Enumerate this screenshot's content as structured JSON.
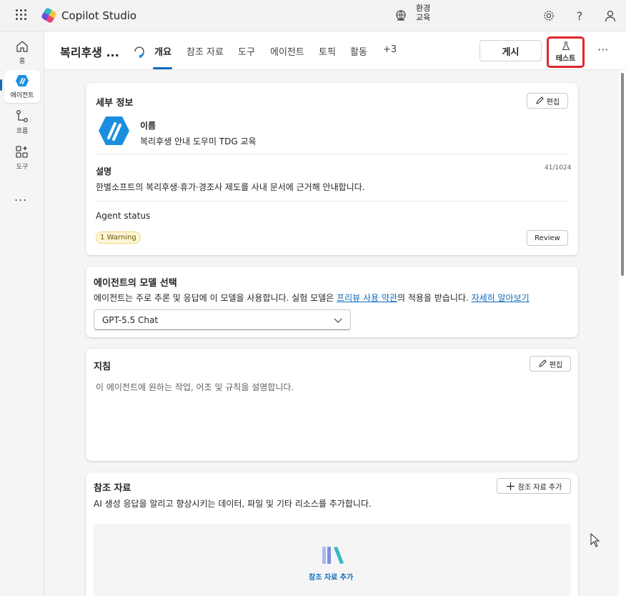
{
  "topbar": {
    "app_title": "Copilot Studio",
    "env_label_1": "환경",
    "env_label_2": "교육",
    "icons": [
      "waffle-icon",
      "settings-icon",
      "help-icon",
      "profile-icon"
    ]
  },
  "rail": {
    "items": [
      {
        "label": "홈",
        "icon": "home-icon"
      },
      {
        "label": "에이전트",
        "icon": "agent-icon"
      },
      {
        "label": "흐름",
        "icon": "flow-icon"
      },
      {
        "label": "도구",
        "icon": "tools-icon"
      }
    ],
    "more": "..."
  },
  "header": {
    "agent_name": "복리후생 ...",
    "tabs": [
      "개요",
      "참조 자료",
      "도구",
      "에이전트",
      "토픽",
      "활동",
      "+3"
    ],
    "publish_label": "게시",
    "test_label": "테스트",
    "more": "···"
  },
  "details": {
    "title": "세부 정보",
    "edit_label": "편집",
    "name_label": "이름",
    "name_value": "복리후생 안내 도우미 TDG 교육",
    "desc_label": "설명",
    "desc_count": "41/1024",
    "desc_value": "한별소프트의 복리후생·휴가·경조사 제도를 사내 문서에 근거해 안내합니다.",
    "status_label": "Agent status",
    "warning": "1 Warning",
    "review_label": "Review"
  },
  "model": {
    "title": "에이전트의 모델 선택",
    "desc_before": "에이전트는 주로 추론 및 응답에 이 모델을 사용합니다. 실험 모델은 ",
    "desc_link": "프리뷰 사용 약관",
    "desc_after": "의 적용을 받습니다. ",
    "learn_more": "자세히 알아보기",
    "selected": "GPT-5.5 Chat"
  },
  "instructions": {
    "title": "지침",
    "edit_label": "편집",
    "placeholder": "이 에이전트에 원하는 작업, 어조 및 규칙을 설명합니다."
  },
  "knowledge": {
    "title": "참조 자료",
    "add_label": "참조 자료 추가",
    "desc": "AI 생성 응답을 알리고 향상시키는 데이터, 파일 및 기타 리소스를 추가합니다.",
    "drop_label": "참조 자료 추가"
  },
  "colors": {
    "accent": "#0f6cbd",
    "highlight_border": "#e0262d",
    "warning_bg": "#fdf6d8"
  }
}
